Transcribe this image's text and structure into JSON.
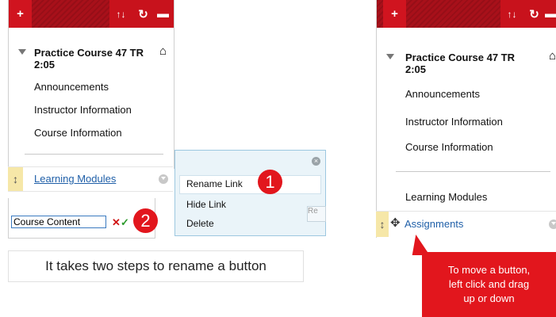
{
  "left_menu": {
    "course_title_line1": "Practice Course 47 TR",
    "course_title_line2": "2:05",
    "items": [
      "Announcements",
      "Instructor Information",
      "Course Information"
    ],
    "selected_item": "Learning Modules"
  },
  "context_menu": {
    "items": [
      "Rename Link",
      "Hide Link",
      "Delete"
    ],
    "ghost_button": "Re"
  },
  "rename": {
    "value": "Course Content"
  },
  "badges": {
    "step1": "1",
    "step2": "2"
  },
  "caption": "It takes two steps to rename a button",
  "right_menu": {
    "course_title_line1": "Practice Course 47 TR",
    "course_title_line2": "2:05",
    "items": [
      "Announcements",
      "Instructor Information",
      "Course Information"
    ],
    "item_after_divider": "Learning Modules",
    "dragging_item": "Assignments"
  },
  "callout": {
    "line1": "To move a button,",
    "line2": "left click and drag",
    "line3": "up or down"
  },
  "colors": {
    "brand_red": "#d0141f",
    "link_blue": "#1f5fa8",
    "callout_red": "#e2161d"
  },
  "icons": [
    "plus-icon",
    "sort-icon",
    "refresh-icon",
    "folder-icon",
    "home-icon",
    "move-handle-icon",
    "chevron-down-icon",
    "close-icon",
    "check-icon",
    "cancel-icon"
  ]
}
